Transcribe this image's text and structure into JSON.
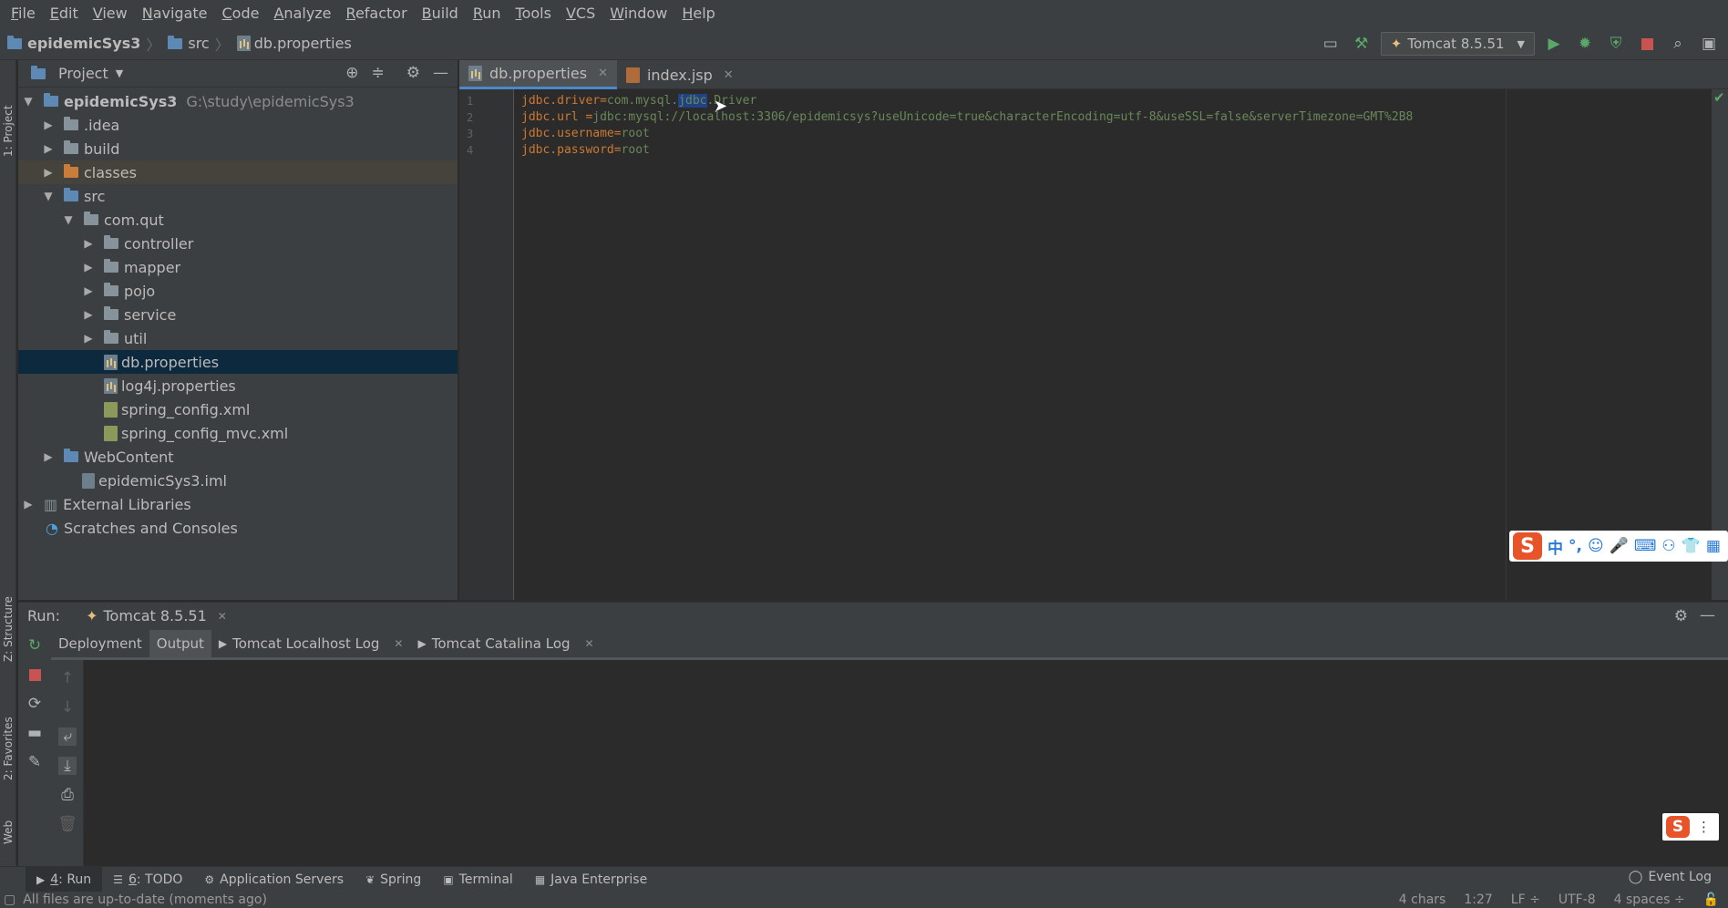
{
  "menu": [
    {
      "label": "File",
      "mn": "F",
      "rest": "ile"
    },
    {
      "label": "Edit",
      "mn": "E",
      "rest": "dit"
    },
    {
      "label": "View",
      "mn": "V",
      "rest": "iew"
    },
    {
      "label": "Navigate",
      "mn": "N",
      "rest": "avigate"
    },
    {
      "label": "Code",
      "mn": "C",
      "rest": "ode"
    },
    {
      "label": "Analyze",
      "mn": "A",
      "rest": "nalyze"
    },
    {
      "label": "Refactor",
      "mn": "R",
      "rest": "efactor"
    },
    {
      "label": "Build",
      "mn": "B",
      "rest": "uild"
    },
    {
      "label": "Run",
      "mn": "R",
      "rest": "un"
    },
    {
      "label": "Tools",
      "mn": "T",
      "rest": "ools"
    },
    {
      "label": "VCS",
      "mn": "V",
      "rest": "CS"
    },
    {
      "label": "Window",
      "mn": "W",
      "rest": "indow"
    },
    {
      "label": "Help",
      "mn": "H",
      "rest": "elp"
    }
  ],
  "breadcrumb": {
    "project": "epidemicSys3",
    "folder": "src",
    "file": "db.properties"
  },
  "run_config": "Tomcat 8.5.51",
  "project_panel": {
    "title": "Project",
    "tree": [
      {
        "label": "epidemicSys3",
        "path": "G:\\study\\epidemicSys3"
      },
      {
        "label": ".idea"
      },
      {
        "label": "build"
      },
      {
        "label": "classes"
      },
      {
        "label": "src"
      },
      {
        "label": "com.qut"
      },
      {
        "label": "controller"
      },
      {
        "label": "mapper"
      },
      {
        "label": "pojo"
      },
      {
        "label": "service"
      },
      {
        "label": "util"
      },
      {
        "label": "db.properties"
      },
      {
        "label": "log4j.properties"
      },
      {
        "label": "spring_config.xml"
      },
      {
        "label": "spring_config_mvc.xml"
      },
      {
        "label": "WebContent"
      },
      {
        "label": "epidemicSys3.iml"
      },
      {
        "label": "External Libraries"
      },
      {
        "label": "Scratches and Consoles"
      }
    ]
  },
  "left_stripe": {
    "project": "1: Project",
    "structure": "Z: Structure",
    "favorites": "2: Favorites",
    "web": "Web"
  },
  "editor": {
    "tabs": [
      {
        "label": "db.properties"
      },
      {
        "label": "index.jsp"
      }
    ],
    "lines": [
      {
        "num": "1",
        "key": "jdbc.driver",
        "eq": "=",
        "v1": "com.mysql.",
        "sel": "jdbc",
        "v2": ".Driver"
      },
      {
        "num": "2",
        "key": "jdbc.url ",
        "eq": "=",
        "v1": "jdbc:mysql://localhost:3306/epidemicsys?useUnicode=true&characterEncoding=utf-8&useSSL=false&serverTimezone=GMT%2B8",
        "sel": "",
        "v2": ""
      },
      {
        "num": "3",
        "key": "jdbc.username",
        "eq": "=",
        "v1": "root",
        "sel": "",
        "v2": ""
      },
      {
        "num": "4",
        "key": "jdbc.password",
        "eq": "=",
        "v1": "root",
        "sel": "",
        "v2": ""
      }
    ]
  },
  "run_panel": {
    "label": "Run:",
    "config_tab": "Tomcat 8.5.51",
    "tabs": [
      {
        "label": "Deployment"
      },
      {
        "label": "Output"
      },
      {
        "label": "Tomcat Localhost Log"
      },
      {
        "label": "Tomcat Catalina Log"
      }
    ]
  },
  "bottom_tabs": [
    {
      "num": "4",
      "label": ": Run"
    },
    {
      "num": "6",
      "label": ": TODO"
    },
    {
      "num": "",
      "label": "Application Servers"
    },
    {
      "num": "",
      "label": "Spring"
    },
    {
      "num": "",
      "label": "Terminal"
    },
    {
      "num": "",
      "label": "Java Enterprise"
    }
  ],
  "event_log": "Event Log",
  "status": {
    "message": "All files are up-to-date (moments ago)",
    "chars": "4 chars",
    "position": "1:27",
    "line_sep": "LF ÷",
    "encoding": "UTF-8",
    "indent": "4 spaces ÷"
  },
  "ime": {
    "logo": "S",
    "lang": "中",
    "punct": "°,"
  },
  "colors": {
    "accent": "#4a88c7",
    "selection": "#0d293e",
    "run_green": "#59a869",
    "stop_red": "#c75450"
  }
}
